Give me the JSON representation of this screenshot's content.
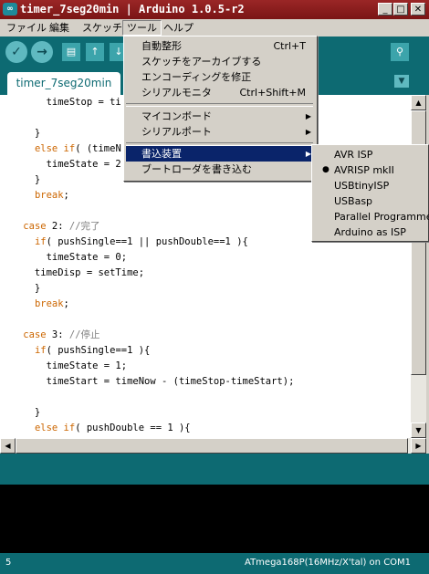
{
  "window": {
    "title": "timer_7seg20min | Arduino 1.0.5-r2",
    "icon": "arduino-logo-icon"
  },
  "menubar": {
    "items": [
      "ファイル",
      "編集",
      "スケッチ",
      "ツール",
      "ヘルプ"
    ]
  },
  "tab": {
    "label": "timer_7seg20min"
  },
  "tools_menu": {
    "items": [
      {
        "label": "自動整形",
        "shortcut": "Ctrl+T"
      },
      {
        "label": "スケッチをアーカイブする"
      },
      {
        "label": "エンコーディングを修正"
      },
      {
        "label": "シリアルモニタ",
        "shortcut": "Ctrl+Shift+M"
      },
      {
        "label": "マイコンボード"
      },
      {
        "label": "シリアルポート"
      },
      {
        "label": "書込装置"
      },
      {
        "label": "ブートローダを書き込む"
      }
    ]
  },
  "programmer_menu": {
    "items": [
      "AVR ISP",
      "AVRISP mkII",
      "USBtinyISP",
      "USBasp",
      "Parallel Programmer",
      "Arduino as ISP"
    ],
    "selected": "AVRISP mkII"
  },
  "code_lines": [
    "        timeStop = ti",
    "",
    "      }",
    "      else if( (timeN",
    "        timeState = 2",
    "      }",
    "      break;",
    "",
    "    case 2: //完了",
    "      if( pushSingle==1 || pushDouble==1 ){",
    "        timeState = 0;",
    "      timeDisp = setTime;",
    "      }",
    "      break;",
    "",
    "    case 3: //停止",
    "      if( pushSingle==1 ){",
    "        timeState = 1;",
    "        timeStart = timeNow - (timeStop-timeStart);",
    "",
    "      }",
    "      else if( pushDouble == 1 ){"
  ],
  "status": {
    "line": "5",
    "board": "ATmega168P(16MHz/X'tal) on COM1"
  },
  "colors": {
    "teal": "#0d6a72",
    "titlebar": "#8b1e1e",
    "highlight": "#0a246a",
    "keyword": "#cc6600"
  }
}
